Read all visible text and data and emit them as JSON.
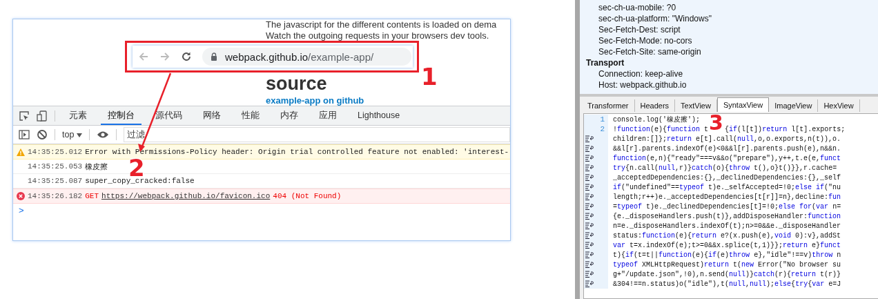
{
  "browser": {
    "page_lines": [
      "The javascript for the different contents is loaded on dema",
      "Watch the outgoing requests in your browsers dev tools."
    ],
    "heading": "source",
    "link": "example-app on github",
    "address_bar": {
      "host": "webpack.github.io",
      "path": "/example-app/"
    },
    "devtools": {
      "tabs": [
        {
          "label": "元素",
          "selected": false
        },
        {
          "label": "控制台",
          "selected": true
        },
        {
          "label": "源代码",
          "selected": false
        },
        {
          "label": "网络",
          "selected": false
        },
        {
          "label": "性能",
          "selected": false
        },
        {
          "label": "内存",
          "selected": false
        },
        {
          "label": "应用",
          "selected": false
        },
        {
          "label": "Lighthouse",
          "selected": false
        }
      ],
      "context": "top",
      "filter": {
        "placeholder": "过滤"
      },
      "messages": [
        {
          "kind": "warning",
          "time": "14:35:25.012",
          "text": "Error with Permissions-Policy header: Origin trial controlled feature not enabled: 'interest-"
        },
        {
          "kind": "log",
          "time": "14:35:25.053",
          "text": "橡皮擦"
        },
        {
          "kind": "log",
          "time": "14:35:25.087",
          "text": "super_copy_cracked:false"
        },
        {
          "kind": "error",
          "time": "14:35:26.182",
          "method": "GET",
          "url": "https://webpack.github.io/favicon.ico",
          "status": "404 (Not Found)"
        }
      ],
      "prompt": ">"
    }
  },
  "annotations": [
    "1",
    "2",
    "3"
  ],
  "inspector": {
    "headers": [
      {
        "kind": "header",
        "text": "sec-ch-ua-mobile: ?0"
      },
      {
        "kind": "header",
        "text": "sec-ch-ua-platform: \"Windows\""
      },
      {
        "kind": "header",
        "text": "Sec-Fetch-Dest: script"
      },
      {
        "kind": "header",
        "text": "Sec-Fetch-Mode: no-cors"
      },
      {
        "kind": "header",
        "text": "Sec-Fetch-Site: same-origin"
      },
      {
        "kind": "group",
        "text": "Transport"
      },
      {
        "kind": "header",
        "text": "Connection: keep-alive"
      },
      {
        "kind": "header",
        "text": "Host: webpack.github.io"
      }
    ],
    "tabs": [
      {
        "label": "Transformer",
        "selected": false
      },
      {
        "label": "Headers",
        "selected": false
      },
      {
        "label": "TextView",
        "selected": false
      },
      {
        "label": "SyntaxView",
        "selected": true
      },
      {
        "label": "ImageView",
        "selected": false
      },
      {
        "label": "HexView",
        "selected": false
      }
    ],
    "code": [
      {
        "kind": "numbered",
        "number": "1",
        "segments": [
          {
            "kind": "plain",
            "text": "console.log('橡皮擦');"
          }
        ]
      },
      {
        "kind": "numbered",
        "number": "2",
        "segments": [
          {
            "kind": "plain",
            "text": "!"
          },
          {
            "kind": "keyword",
            "text": "function"
          },
          {
            "kind": "plain",
            "text": "(e){"
          },
          {
            "kind": "keyword",
            "text": "function"
          },
          {
            "kind": "plain",
            "text": " t"
          },
          {
            "kind": "gap"
          },
          {
            "kind": "plain",
            "text": "{"
          },
          {
            "kind": "keyword",
            "text": "if"
          },
          {
            "kind": "plain",
            "text": "(l[t])"
          },
          {
            "kind": "keyword",
            "text": "return"
          },
          {
            "kind": "plain",
            "text": " l[t].exports;"
          }
        ]
      },
      {
        "kind": "wrapped",
        "segments": [
          {
            "kind": "plain",
            "text": "children:[]};"
          },
          {
            "kind": "keyword",
            "text": "return"
          },
          {
            "kind": "plain",
            "text": " e[t].call("
          },
          {
            "kind": "keyword",
            "text": "null"
          },
          {
            "kind": "plain",
            "text": ",o,o.exports,n(t)),o."
          }
        ]
      },
      {
        "kind": "wrapped",
        "segments": [
          {
            "kind": "plain",
            "text": "&&l[r].parents.indexOf(e)<0&&l[r].parents.push(e),n&&n."
          }
        ]
      },
      {
        "kind": "wrapped",
        "segments": [
          {
            "kind": "keyword",
            "text": "function"
          },
          {
            "kind": "plain",
            "text": "(e,n){\"ready\"===v&&o(\"prepare\"),y++,t.e(e,"
          },
          {
            "kind": "keyword",
            "text": "funct"
          }
        ]
      },
      {
        "kind": "wrapped",
        "segments": [
          {
            "kind": "keyword",
            "text": "try"
          },
          {
            "kind": "plain",
            "text": "{n.call("
          },
          {
            "kind": "keyword",
            "text": "null"
          },
          {
            "kind": "plain",
            "text": ",r)}"
          },
          {
            "kind": "keyword",
            "text": "catch"
          },
          {
            "kind": "plain",
            "text": "(o){"
          },
          {
            "kind": "keyword",
            "text": "throw"
          },
          {
            "kind": "plain",
            "text": " t(),o}t()}},r.cache="
          }
        ]
      },
      {
        "kind": "wrapped",
        "segments": [
          {
            "kind": "plain",
            "text": "_acceptedDependencies:{},_declinedDependencies:{},_self"
          }
        ]
      },
      {
        "kind": "wrapped",
        "segments": [
          {
            "kind": "keyword",
            "text": "if"
          },
          {
            "kind": "plain",
            "text": "(\"undefined\"=="
          },
          {
            "kind": "keyword",
            "text": "typeof"
          },
          {
            "kind": "plain",
            "text": " t)e._selfAccepted=!0;"
          },
          {
            "kind": "keyword",
            "text": "else if"
          },
          {
            "kind": "plain",
            "text": "(\"nu"
          }
        ]
      },
      {
        "kind": "wrapped",
        "segments": [
          {
            "kind": "plain",
            "text": "length;r++)e._acceptedDependencies[t[r]]=n},decline:"
          },
          {
            "kind": "keyword",
            "text": "fun"
          }
        ]
      },
      {
        "kind": "wrapped",
        "segments": [
          {
            "kind": "plain",
            "text": "="
          },
          {
            "kind": "keyword",
            "text": "typeof"
          },
          {
            "kind": "plain",
            "text": " t)e._declinedDependencies[t]=!0;"
          },
          {
            "kind": "keyword",
            "text": "else for"
          },
          {
            "kind": "plain",
            "text": "("
          },
          {
            "kind": "keyword",
            "text": "var"
          },
          {
            "kind": "plain",
            "text": " n="
          }
        ]
      },
      {
        "kind": "wrapped",
        "segments": [
          {
            "kind": "plain",
            "text": "{e._disposeHandlers.push(t)},addDisposeHandler:"
          },
          {
            "kind": "keyword",
            "text": "function"
          }
        ]
      },
      {
        "kind": "wrapped",
        "segments": [
          {
            "kind": "plain",
            "text": "n=e._disposeHandlers.indexOf(t);n>=0&&e._disposeHandler"
          }
        ]
      },
      {
        "kind": "wrapped",
        "segments": [
          {
            "kind": "plain",
            "text": "status:"
          },
          {
            "kind": "keyword",
            "text": "function"
          },
          {
            "kind": "plain",
            "text": "(e){"
          },
          {
            "kind": "keyword",
            "text": "return"
          },
          {
            "kind": "plain",
            "text": " e?(x.push(e),"
          },
          {
            "kind": "keyword",
            "text": "void"
          },
          {
            "kind": "plain",
            "text": " 0):v},addSt"
          }
        ]
      },
      {
        "kind": "wrapped",
        "segments": [
          {
            "kind": "keyword",
            "text": "var"
          },
          {
            "kind": "plain",
            "text": " t=x.indexOf(e);t>=0&&x.splice(t,1)}};"
          },
          {
            "kind": "keyword",
            "text": "return"
          },
          {
            "kind": "plain",
            "text": " e}"
          },
          {
            "kind": "keyword",
            "text": "funct"
          }
        ]
      },
      {
        "kind": "wrapped",
        "segments": [
          {
            "kind": "plain",
            "text": "t){"
          },
          {
            "kind": "keyword",
            "text": "if"
          },
          {
            "kind": "plain",
            "text": "(t=t||"
          },
          {
            "kind": "keyword",
            "text": "function"
          },
          {
            "kind": "plain",
            "text": "(e){"
          },
          {
            "kind": "keyword",
            "text": "if"
          },
          {
            "kind": "plain",
            "text": "(e)"
          },
          {
            "kind": "keyword",
            "text": "throw"
          },
          {
            "kind": "plain",
            "text": " e},\"idle\"!==v)"
          },
          {
            "kind": "keyword",
            "text": "throw"
          },
          {
            "kind": "plain",
            "text": " n"
          }
        ]
      },
      {
        "kind": "wrapped",
        "segments": [
          {
            "kind": "keyword",
            "text": "typeof"
          },
          {
            "kind": "plain",
            "text": " XMLHttpRequest)"
          },
          {
            "kind": "keyword",
            "text": "return"
          },
          {
            "kind": "plain",
            "text": " t("
          },
          {
            "kind": "keyword",
            "text": "new"
          },
          {
            "kind": "plain",
            "text": " Error(\"No browser su"
          }
        ]
      },
      {
        "kind": "wrapped",
        "segments": [
          {
            "kind": "plain",
            "text": "g+\"/update.json\",!0),n.send("
          },
          {
            "kind": "keyword",
            "text": "null"
          },
          {
            "kind": "plain",
            "text": ")}"
          },
          {
            "kind": "keyword",
            "text": "catch"
          },
          {
            "kind": "plain",
            "text": "(r){"
          },
          {
            "kind": "keyword",
            "text": "return"
          },
          {
            "kind": "plain",
            "text": " t(r)}"
          }
        ]
      },
      {
        "kind": "wrapped",
        "segments": [
          {
            "kind": "plain",
            "text": "&304!==n.status)o(\"idle\"),t("
          },
          {
            "kind": "keyword",
            "text": "null"
          },
          {
            "kind": "plain",
            "text": ","
          },
          {
            "kind": "keyword",
            "text": "null"
          },
          {
            "kind": "plain",
            "text": ");"
          },
          {
            "kind": "keyword",
            "text": "else"
          },
          {
            "kind": "plain",
            "text": "{"
          },
          {
            "kind": "keyword",
            "text": "try"
          },
          {
            "kind": "plain",
            "text": "{"
          },
          {
            "kind": "keyword",
            "text": "var"
          },
          {
            "kind": "plain",
            "text": " e=J"
          }
        ]
      }
    ]
  }
}
